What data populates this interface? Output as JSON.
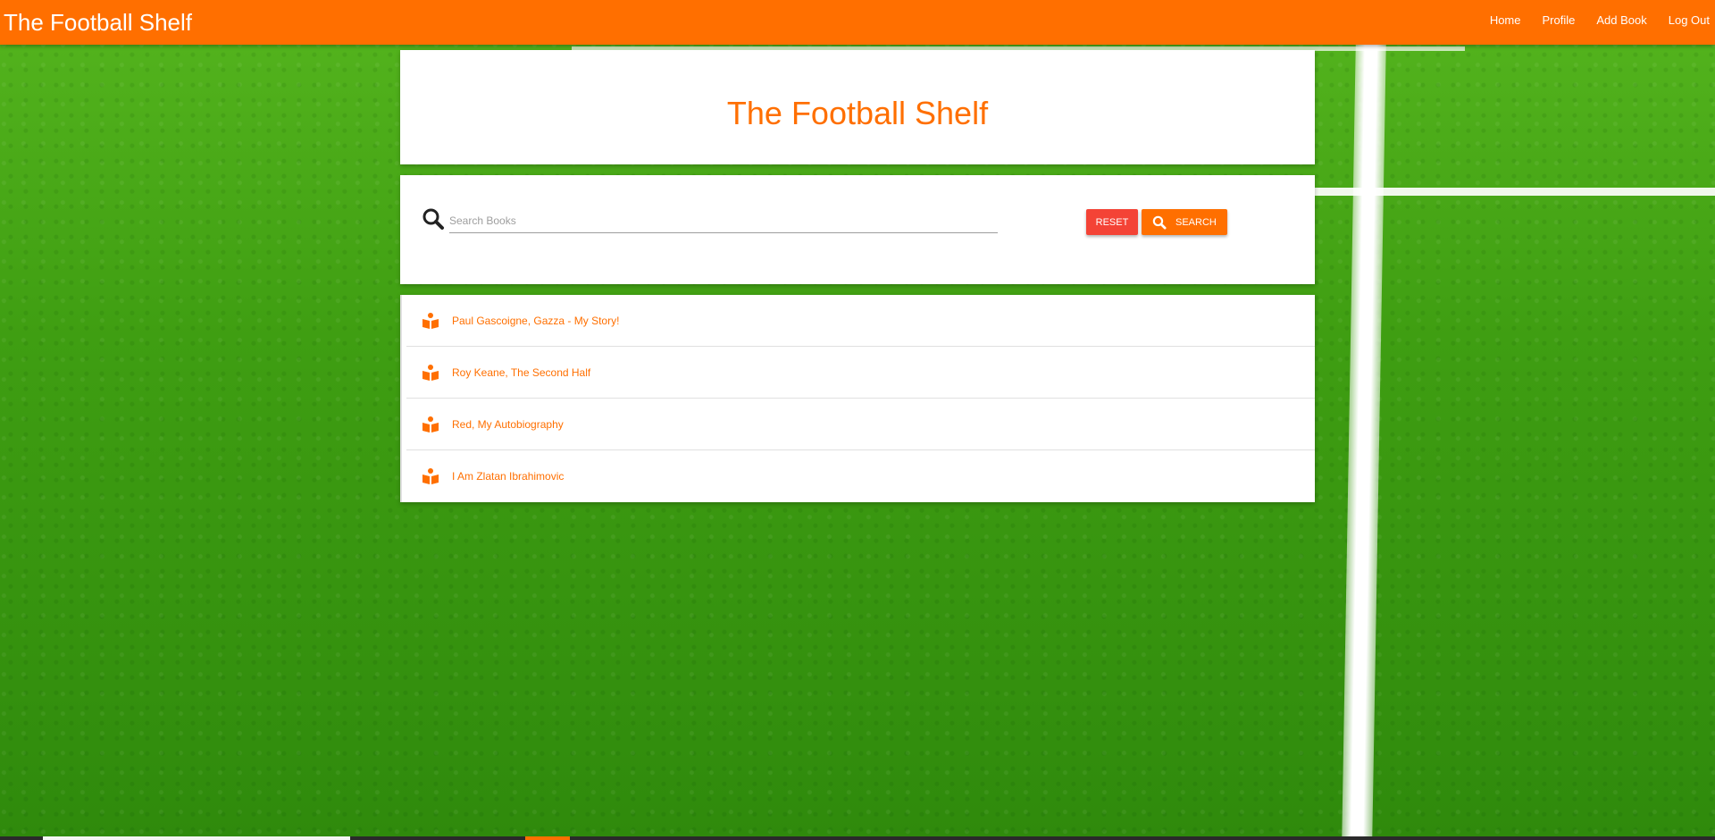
{
  "navbar": {
    "brand": "The Football Shelf",
    "links": [
      "Home",
      "Profile",
      "Add Book",
      "Log Out"
    ]
  },
  "header": {
    "title": "The Football Shelf"
  },
  "search": {
    "placeholder": "Search Books",
    "value": "",
    "reset_label": "RESET",
    "search_label": "SEARCH"
  },
  "books": [
    "Paul Gascoigne, Gazza - My Story!",
    "Roy Keane, The Second Half",
    "Red, My Autobiography",
    "I Am Zlatan Ibrahimovic"
  ],
  "icons": {
    "search": "search-icon",
    "book": "book-reader-icon"
  },
  "colors": {
    "primary": "#ff6f00",
    "reset": "#f44336",
    "field": "#3f9e12"
  }
}
